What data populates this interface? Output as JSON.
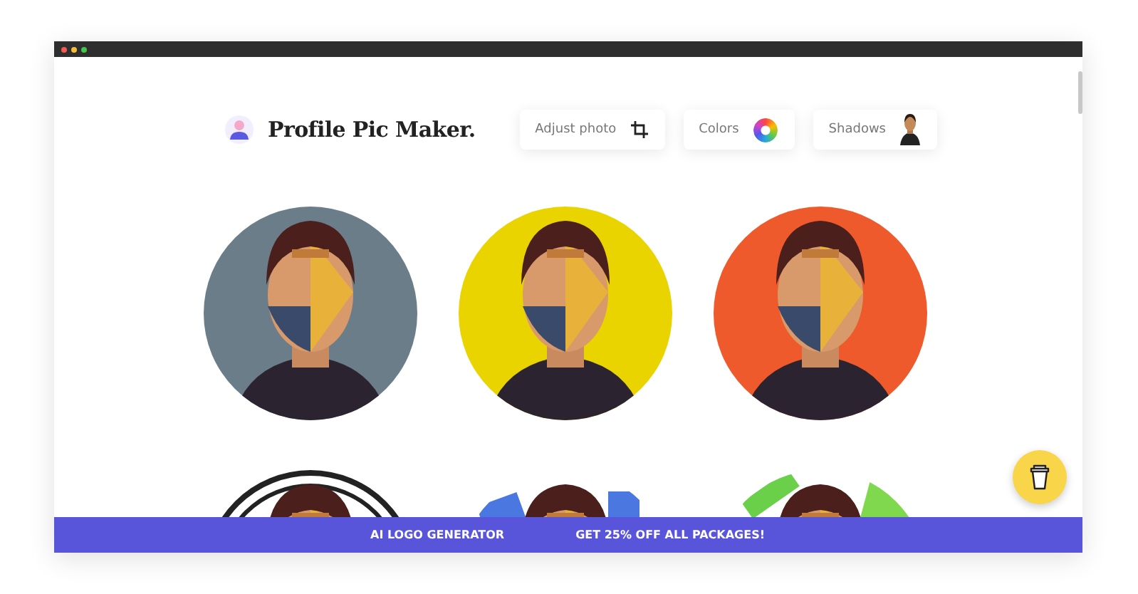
{
  "header": {
    "title": "Profile Pic Maker."
  },
  "tools": [
    {
      "label": "Adjust photo",
      "kind": "crop"
    },
    {
      "label": "Colors",
      "kind": "wheel"
    },
    {
      "label": "Shadows",
      "kind": "avatar"
    }
  ],
  "banner": {
    "links": [
      "AI LOGO GENERATOR",
      "GET 25% OFF ALL PACKAGES!"
    ]
  }
}
